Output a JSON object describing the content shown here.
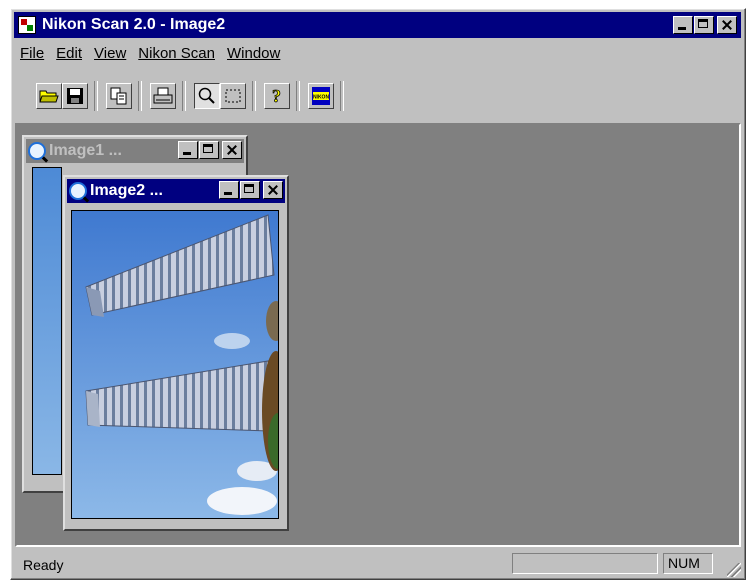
{
  "window": {
    "title": "Nikon Scan 2.0 - Image2"
  },
  "menu": {
    "items": [
      "File",
      "Edit",
      "View",
      "Nikon Scan",
      "Window"
    ]
  },
  "toolbar": {
    "buttons": [
      "open-icon",
      "save-icon",
      "copy-icon",
      "print-icon",
      "zoom-icon",
      "select-icon",
      "help-icon",
      "nikon-icon"
    ],
    "logo_text": "NIKON"
  },
  "children": [
    {
      "title": "Image1 ...",
      "active": false
    },
    {
      "title": "Image2 ...",
      "active": true
    }
  ],
  "status": {
    "text": "Ready",
    "num": "NUM"
  },
  "colors": {
    "active_title": "#000080",
    "inactive_title": "#808080",
    "mdi_bg": "#808080",
    "face": "#c0c0c0"
  }
}
